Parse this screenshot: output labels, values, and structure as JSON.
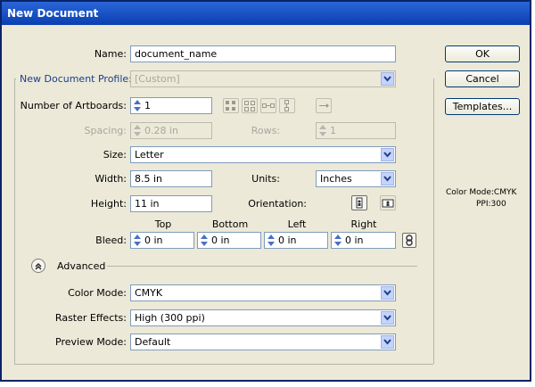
{
  "window": {
    "title": "New Document"
  },
  "form": {
    "name_label": "Name:",
    "name_value": "document_name",
    "profile_label": "New Document Profile:",
    "profile_value": "[Custom]",
    "artboards_label": "Number of Artboards:",
    "artboards_value": "1",
    "spacing_label": "Spacing:",
    "spacing_value": "0.28 in",
    "rows_label": "Rows:",
    "rows_value": "1",
    "size_label": "Size:",
    "size_value": "Letter",
    "width_label": "Width:",
    "width_value": "8.5 in",
    "units_label": "Units:",
    "units_value": "Inches",
    "height_label": "Height:",
    "height_value": "11 in",
    "orientation_label": "Orientation:",
    "bleed_label": "Bleed:",
    "bleed_top_label": "Top",
    "bleed_bottom_label": "Bottom",
    "bleed_left_label": "Left",
    "bleed_right_label": "Right",
    "bleed_top": "0 in",
    "bleed_bottom": "0 in",
    "bleed_left": "0 in",
    "bleed_right": "0 in",
    "advanced_label": "Advanced",
    "color_mode_label": "Color Mode:",
    "color_mode_value": "CMYK",
    "raster_label": "Raster Effects:",
    "raster_value": "High (300 ppi)",
    "preview_label": "Preview Mode:",
    "preview_value": "Default"
  },
  "buttons": {
    "ok": "OK",
    "cancel": "Cancel",
    "templates": "Templates..."
  },
  "info": {
    "color_mode": "Color Mode:CMYK",
    "ppi": "PPI:300"
  },
  "icons": {
    "artboard_layout": [
      "grid-by-row-icon",
      "grid-by-column-icon",
      "arrange-by-row-icon",
      "arrange-by-column-icon",
      "right-to-left-icon"
    ],
    "orientation": [
      "portrait-icon",
      "landscape-icon"
    ],
    "bleed_link": "link-bleed-icon",
    "advanced_toggle": "expand-chevron-icon"
  },
  "colors": {
    "title_bar": "#0a3fb0",
    "dialog_bg": "#ece9d8",
    "profile_label": "#1a3e8c",
    "disabled_text": "#a8a6a0"
  }
}
